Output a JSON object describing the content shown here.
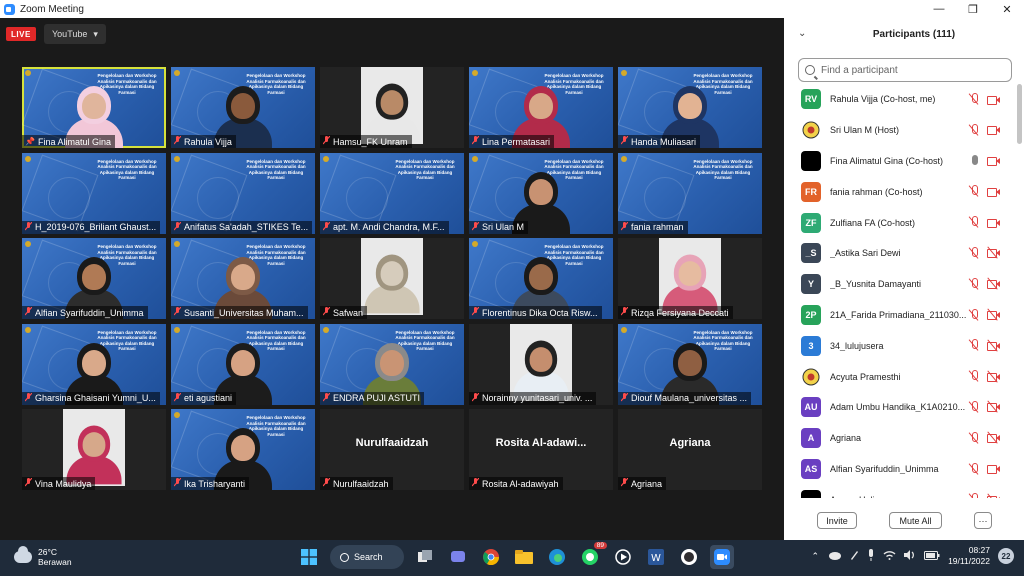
{
  "window": {
    "title": "Zoom Meeting",
    "min": "—",
    "restore": "❐",
    "close": "✕"
  },
  "toolbar": {
    "live_label": "LIVE",
    "youtube_label": "YouTube",
    "youtube_caret": "▾"
  },
  "slide_text": "Pengelolaan dan Workshop Analisis Farmakoanalis dan Apikasinya dalam Bidang Farmasi",
  "tiles": [
    {
      "name": "Fina Alimatul Gina",
      "kind": "person-slide",
      "active": true,
      "mic": "pin",
      "skin": "#e0b59c",
      "top": "#f2c7d8",
      "hijab": "#f3cfe0"
    },
    {
      "name": "Rahula Vijja",
      "kind": "person-slide",
      "mic": "off",
      "skin": "#8a5a3c",
      "top": "#1b2f4f",
      "hijab": "#1c1c1c"
    },
    {
      "name": "Hamsu_FK Unram",
      "kind": "still-dark",
      "mic": "off",
      "skin": "#b98a67",
      "top": "#e8e8e8",
      "hijab": "#222"
    },
    {
      "name": "Lina Permatasari",
      "kind": "person-slide",
      "mic": "off",
      "skin": "#d8a888",
      "top": "#b22b4a",
      "hijab": "#b22b4a"
    },
    {
      "name": "Handa Muliasari",
      "kind": "person-slide",
      "mic": "off",
      "skin": "#e2b393",
      "top": "#1e3563",
      "hijab": "#1e3563"
    },
    {
      "name": "H_2019-076_Briliant Ghaust...",
      "kind": "slide",
      "mic": "off"
    },
    {
      "name": "Anifatus Sa'adah_STIKES Te...",
      "kind": "slide",
      "mic": "off"
    },
    {
      "name": "apt. M. Andi Chandra, M.F...",
      "kind": "slide",
      "mic": "off"
    },
    {
      "name": "Sri Ulan M",
      "kind": "person-slide",
      "mic": "off",
      "skin": "#c89272",
      "top": "#1a1a1a",
      "hijab": "#1a1a1a"
    },
    {
      "name": "fania rahman",
      "kind": "slide",
      "mic": "off"
    },
    {
      "name": "Alfian Syarifuddin_Unimma",
      "kind": "person-slide",
      "mic": "off",
      "skin": "#b07a55",
      "top": "#2d2d2d",
      "hijab": "#1a1a1a"
    },
    {
      "name": "Susanti_Universitas Muham...",
      "kind": "person-slide",
      "mic": "off",
      "skin": "#d9a98a",
      "top": "#6b4a3a",
      "hijab": "#7d5a46"
    },
    {
      "name": "Safwan",
      "kind": "still-dark",
      "mic": "off",
      "skin": "#d6ccbc",
      "top": "#cfc6b4",
      "hijab": "#a09580"
    },
    {
      "name": "Florentinus Dika Octa Risw...",
      "kind": "person-slide",
      "mic": "off",
      "skin": "#9a6a4a",
      "top": "#3c4a5e",
      "hijab": "#1a1a1a"
    },
    {
      "name": "Rizqa Fersiyana Deccati",
      "kind": "still-dark",
      "mic": "off",
      "skin": "#e6bba0",
      "top": "#d65b7a",
      "hijab": "#e7a3b7"
    },
    {
      "name": "Gharsina Ghaisani Yumni_U...",
      "kind": "person-slide",
      "mic": "off",
      "skin": "#d9a98a",
      "top": "#1a1a1a",
      "hijab": "#1a1a1a"
    },
    {
      "name": "eti agustiani",
      "kind": "person-slide",
      "mic": "off",
      "skin": "#d6a283",
      "top": "#1c1c1c",
      "hijab": "#1c1c1c"
    },
    {
      "name": "ENDRA PUJI ASTUTI",
      "kind": "person-slide",
      "mic": "off",
      "skin": "#c99474",
      "top": "#6a7d3a",
      "hijab": "#8a8a8a"
    },
    {
      "name": "Norainny yunitasari_univ. ...",
      "kind": "still-dark",
      "mic": "off",
      "skin": "#c58e6e",
      "top": "#e8eef4",
      "hijab": "#222"
    },
    {
      "name": "Diouf Maulana_universitas ...",
      "kind": "person-slide",
      "mic": "off",
      "skin": "#8f5f42",
      "top": "#2a2a2a",
      "hijab": "#1a1a1a"
    },
    {
      "name": "Vina Maulidya",
      "kind": "still-dark",
      "mic": "off",
      "skin": "#d6a88a",
      "top": "#c2315a",
      "hijab": "#c2315a"
    },
    {
      "name": "Ika Trisharyanti",
      "kind": "person-slide",
      "mic": "off",
      "skin": "#d6a283",
      "top": "#1a1a1a",
      "hijab": "#1a1a1a"
    },
    {
      "name": "Nurulfaaidzah",
      "kind": "name",
      "big": "Nurulfaaidzah",
      "mic": "off"
    },
    {
      "name": "Rosita Al-adawiyah",
      "kind": "name",
      "big": "Rosita  Al-adawi...",
      "mic": "off"
    },
    {
      "name": "Agriana",
      "kind": "name",
      "big": "Agriana",
      "mic": "off"
    }
  ],
  "participants": {
    "title": "Participants (111)",
    "chevron": "⌄",
    "search_placeholder": "Find a participant",
    "list": [
      {
        "initials": "RV",
        "color": "#27a35a",
        "name": "Rahula Vijja (Co-host, me)",
        "mic": "off",
        "cam": "on"
      },
      {
        "initials": "",
        "color": "#c89a1a",
        "logo": true,
        "name": "Sri Ulan M (Host)",
        "mic": "off",
        "cam": "on"
      },
      {
        "initials": "",
        "color": "#000000",
        "name": "Fina Alimatul Gina (Co-host)",
        "mic": "on",
        "cam": "on"
      },
      {
        "initials": "FR",
        "color": "#e2622a",
        "name": "fania rahman (Co-host)",
        "mic": "off",
        "cam": "on"
      },
      {
        "initials": "ZF",
        "color": "#2eaa74",
        "name": "Zulfiana FA (Co-host)",
        "mic": "off",
        "cam": "on"
      },
      {
        "initials": "_S",
        "color": "#3b4757",
        "name": "_Astika Sari Dewi",
        "mic": "off",
        "cam": "off"
      },
      {
        "initials": "Y",
        "color": "#3b4757",
        "name": "_B_Yusnita Damayanti",
        "mic": "off",
        "cam": "off"
      },
      {
        "initials": "2P",
        "color": "#27a35a",
        "name": "21A_Farida Primadiana_211030...",
        "mic": "off",
        "cam": "off"
      },
      {
        "initials": "3",
        "color": "#2b7bd6",
        "name": "34_lulujusera",
        "mic": "off",
        "cam": "off"
      },
      {
        "initials": "",
        "color": "#e8eef6",
        "logo": true,
        "name": "Acyuta Pramesthi",
        "mic": "off",
        "cam": "off"
      },
      {
        "initials": "AU",
        "color": "#6a3fc1",
        "name": "Adam Umbu Handika_K1A0210...",
        "mic": "off",
        "cam": "off"
      },
      {
        "initials": "A",
        "color": "#6a3fc1",
        "name": "Agriana",
        "mic": "off",
        "cam": "off"
      },
      {
        "initials": "AS",
        "color": "#6a3fc1",
        "name": "Alfian Syarifuddin_Unimma",
        "mic": "off",
        "cam": "on"
      },
      {
        "initials": "",
        "color": "#000000",
        "name": "Amran Halim",
        "mic": "off",
        "cam": "off"
      }
    ],
    "invite_label": "Invite",
    "mute_all_label": "Mute All",
    "more_label": "···"
  },
  "taskbar": {
    "temp": "26°C",
    "weather": "Berawan",
    "search_label": "Search",
    "whatsapp_badge": "89",
    "tray_up": "⌃",
    "time": "08:27",
    "date": "19/11/2022",
    "notif_count": "22"
  }
}
